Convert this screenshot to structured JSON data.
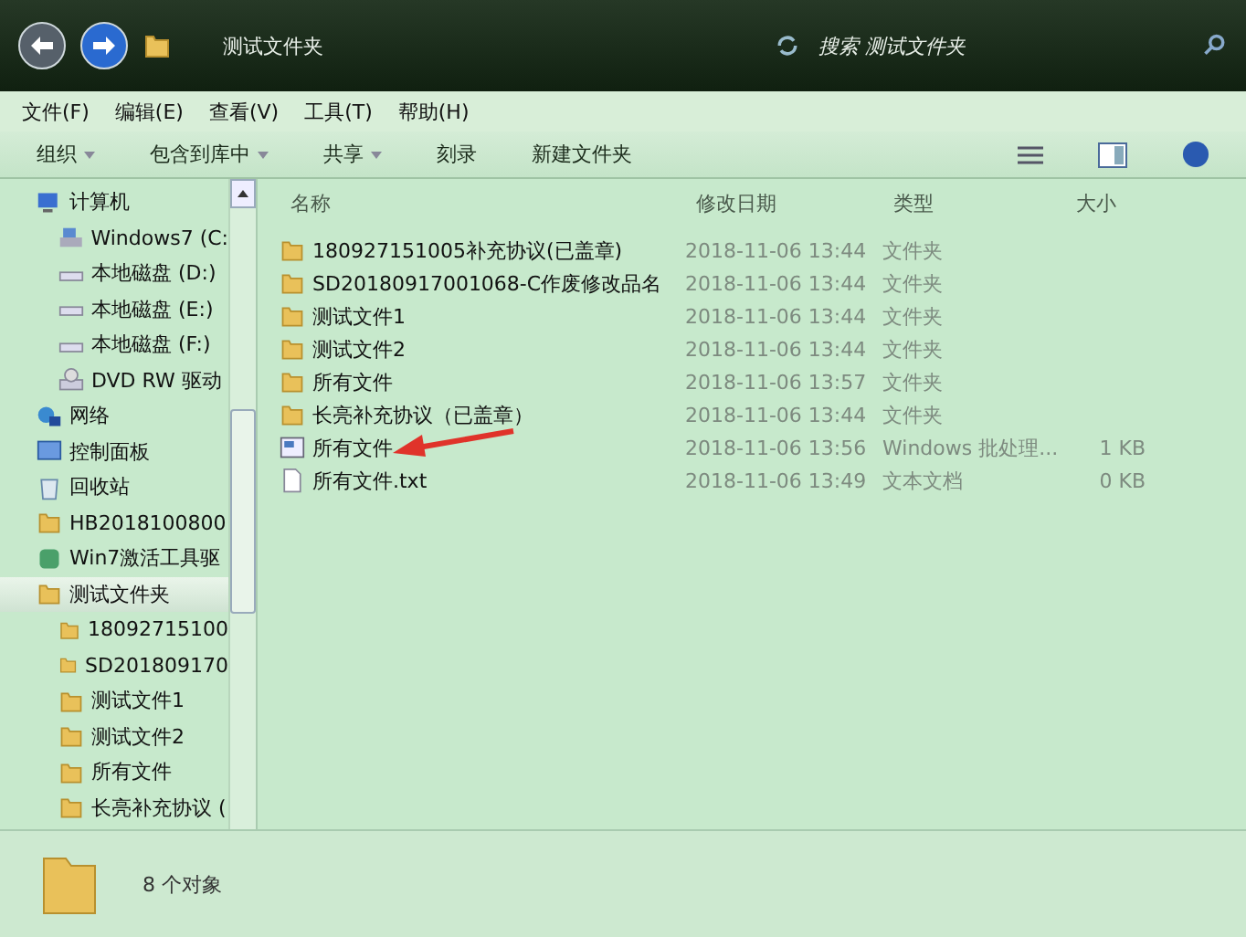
{
  "address": {
    "path": "测试文件夹"
  },
  "search": {
    "placeholder": "搜索 测试文件夹"
  },
  "menu": [
    "文件(F)",
    "编辑(E)",
    "查看(V)",
    "工具(T)",
    "帮助(H)"
  ],
  "toolbar": [
    {
      "label": "组织",
      "dropdown": true
    },
    {
      "label": "包含到库中",
      "dropdown": true
    },
    {
      "label": "共享",
      "dropdown": true
    },
    {
      "label": "刻录",
      "dropdown": false
    },
    {
      "label": "新建文件夹",
      "dropdown": false
    }
  ],
  "sidebar": {
    "items": [
      {
        "label": "计算机",
        "kind": "computer",
        "selected": false,
        "children": [
          {
            "label": "Windows7 (C:",
            "kind": "system-drive",
            "selected": false
          },
          {
            "label": "本地磁盘 (D:)",
            "kind": "drive",
            "selected": false
          },
          {
            "label": "本地磁盘 (E:)",
            "kind": "drive",
            "selected": false
          },
          {
            "label": "本地磁盘 (F:)",
            "kind": "drive",
            "selected": false
          },
          {
            "label": "DVD RW 驱动",
            "kind": "dvd",
            "selected": false
          }
        ]
      },
      {
        "label": "网络",
        "kind": "network",
        "selected": false
      },
      {
        "label": "控制面板",
        "kind": "panel",
        "selected": false
      },
      {
        "label": "回收站",
        "kind": "recycle",
        "selected": false
      },
      {
        "label": "HB2018100800",
        "kind": "folder",
        "selected": false
      },
      {
        "label": "Win7激活工具驱",
        "kind": "app",
        "selected": false
      },
      {
        "label": "测试文件夹",
        "kind": "folder",
        "selected": true,
        "children": [
          {
            "label": "18092715100",
            "kind": "folder",
            "selected": false
          },
          {
            "label": "SD201809170",
            "kind": "folder",
            "selected": false
          },
          {
            "label": "测试文件1",
            "kind": "folder",
            "selected": false
          },
          {
            "label": "测试文件2",
            "kind": "folder",
            "selected": false
          },
          {
            "label": "所有文件",
            "kind": "folder",
            "selected": false
          },
          {
            "label": "长亮补充协议 (",
            "kind": "folder",
            "selected": false
          }
        ]
      }
    ]
  },
  "table": {
    "columns": [
      "名称",
      "修改日期",
      "类型",
      "大小"
    ],
    "rows": [
      {
        "name": "180927151005补充协议(已盖章)",
        "date": "2018-11-06 13:44",
        "type": "文件夹",
        "kind": "folder"
      },
      {
        "name": "SD20180917001068-C作废修改品名",
        "date": "2018-11-06 13:44",
        "type": "文件夹",
        "kind": "folder"
      },
      {
        "name": "测试文件1",
        "date": "2018-11-06 13:44",
        "type": "文件夹",
        "kind": "folder"
      },
      {
        "name": "测试文件2",
        "date": "2018-11-06 13:44",
        "type": "文件夹",
        "kind": "folder"
      },
      {
        "name": "所有文件",
        "date": "2018-11-06 13:57",
        "type": "文件夹",
        "kind": "folder"
      },
      {
        "name": "长亮补充协议（已盖章）",
        "date": "2018-11-06 13:44",
        "type": "文件夹",
        "kind": "folder"
      },
      {
        "name": "所有文件",
        "date": "2018-11-06 13:56",
        "type": "Windows 批处理...",
        "size": "1 KB",
        "kind": "batch"
      },
      {
        "name": "所有文件.txt",
        "date": "2018-11-06 13:49",
        "type": "文本文档",
        "size": "0 KB",
        "kind": "text"
      }
    ]
  },
  "status_bar": {
    "count": "8 个对象"
  }
}
